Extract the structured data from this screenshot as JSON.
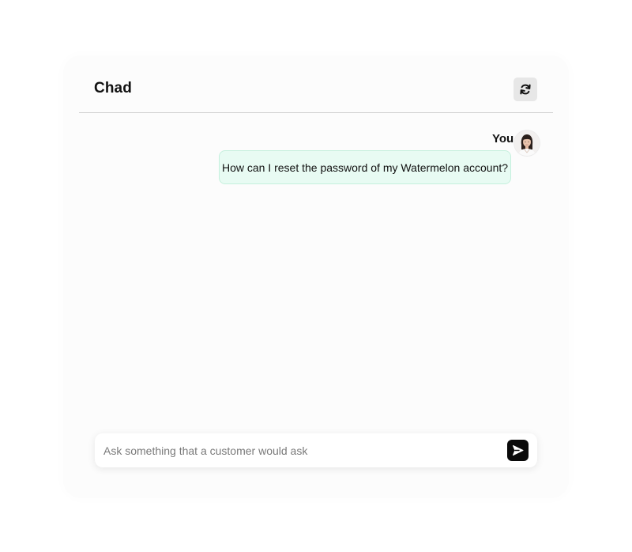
{
  "header": {
    "title": "Chad",
    "refresh_icon": "refresh-icon"
  },
  "messages": [
    {
      "sender": "You",
      "text": "How can I reset the password of my Watermelon account?",
      "avatar_icon": "user-avatar",
      "bubble_color": "#e8fbf3"
    }
  ],
  "composer": {
    "placeholder": "Ask something that a customer would ask",
    "value": "",
    "send_icon": "send-icon"
  },
  "colors": {
    "card_background": "#fcfcfc",
    "bubble_background": "#e8fbf3",
    "bubble_border": "#c5f0dd",
    "send_button": "#0a0a0a"
  }
}
